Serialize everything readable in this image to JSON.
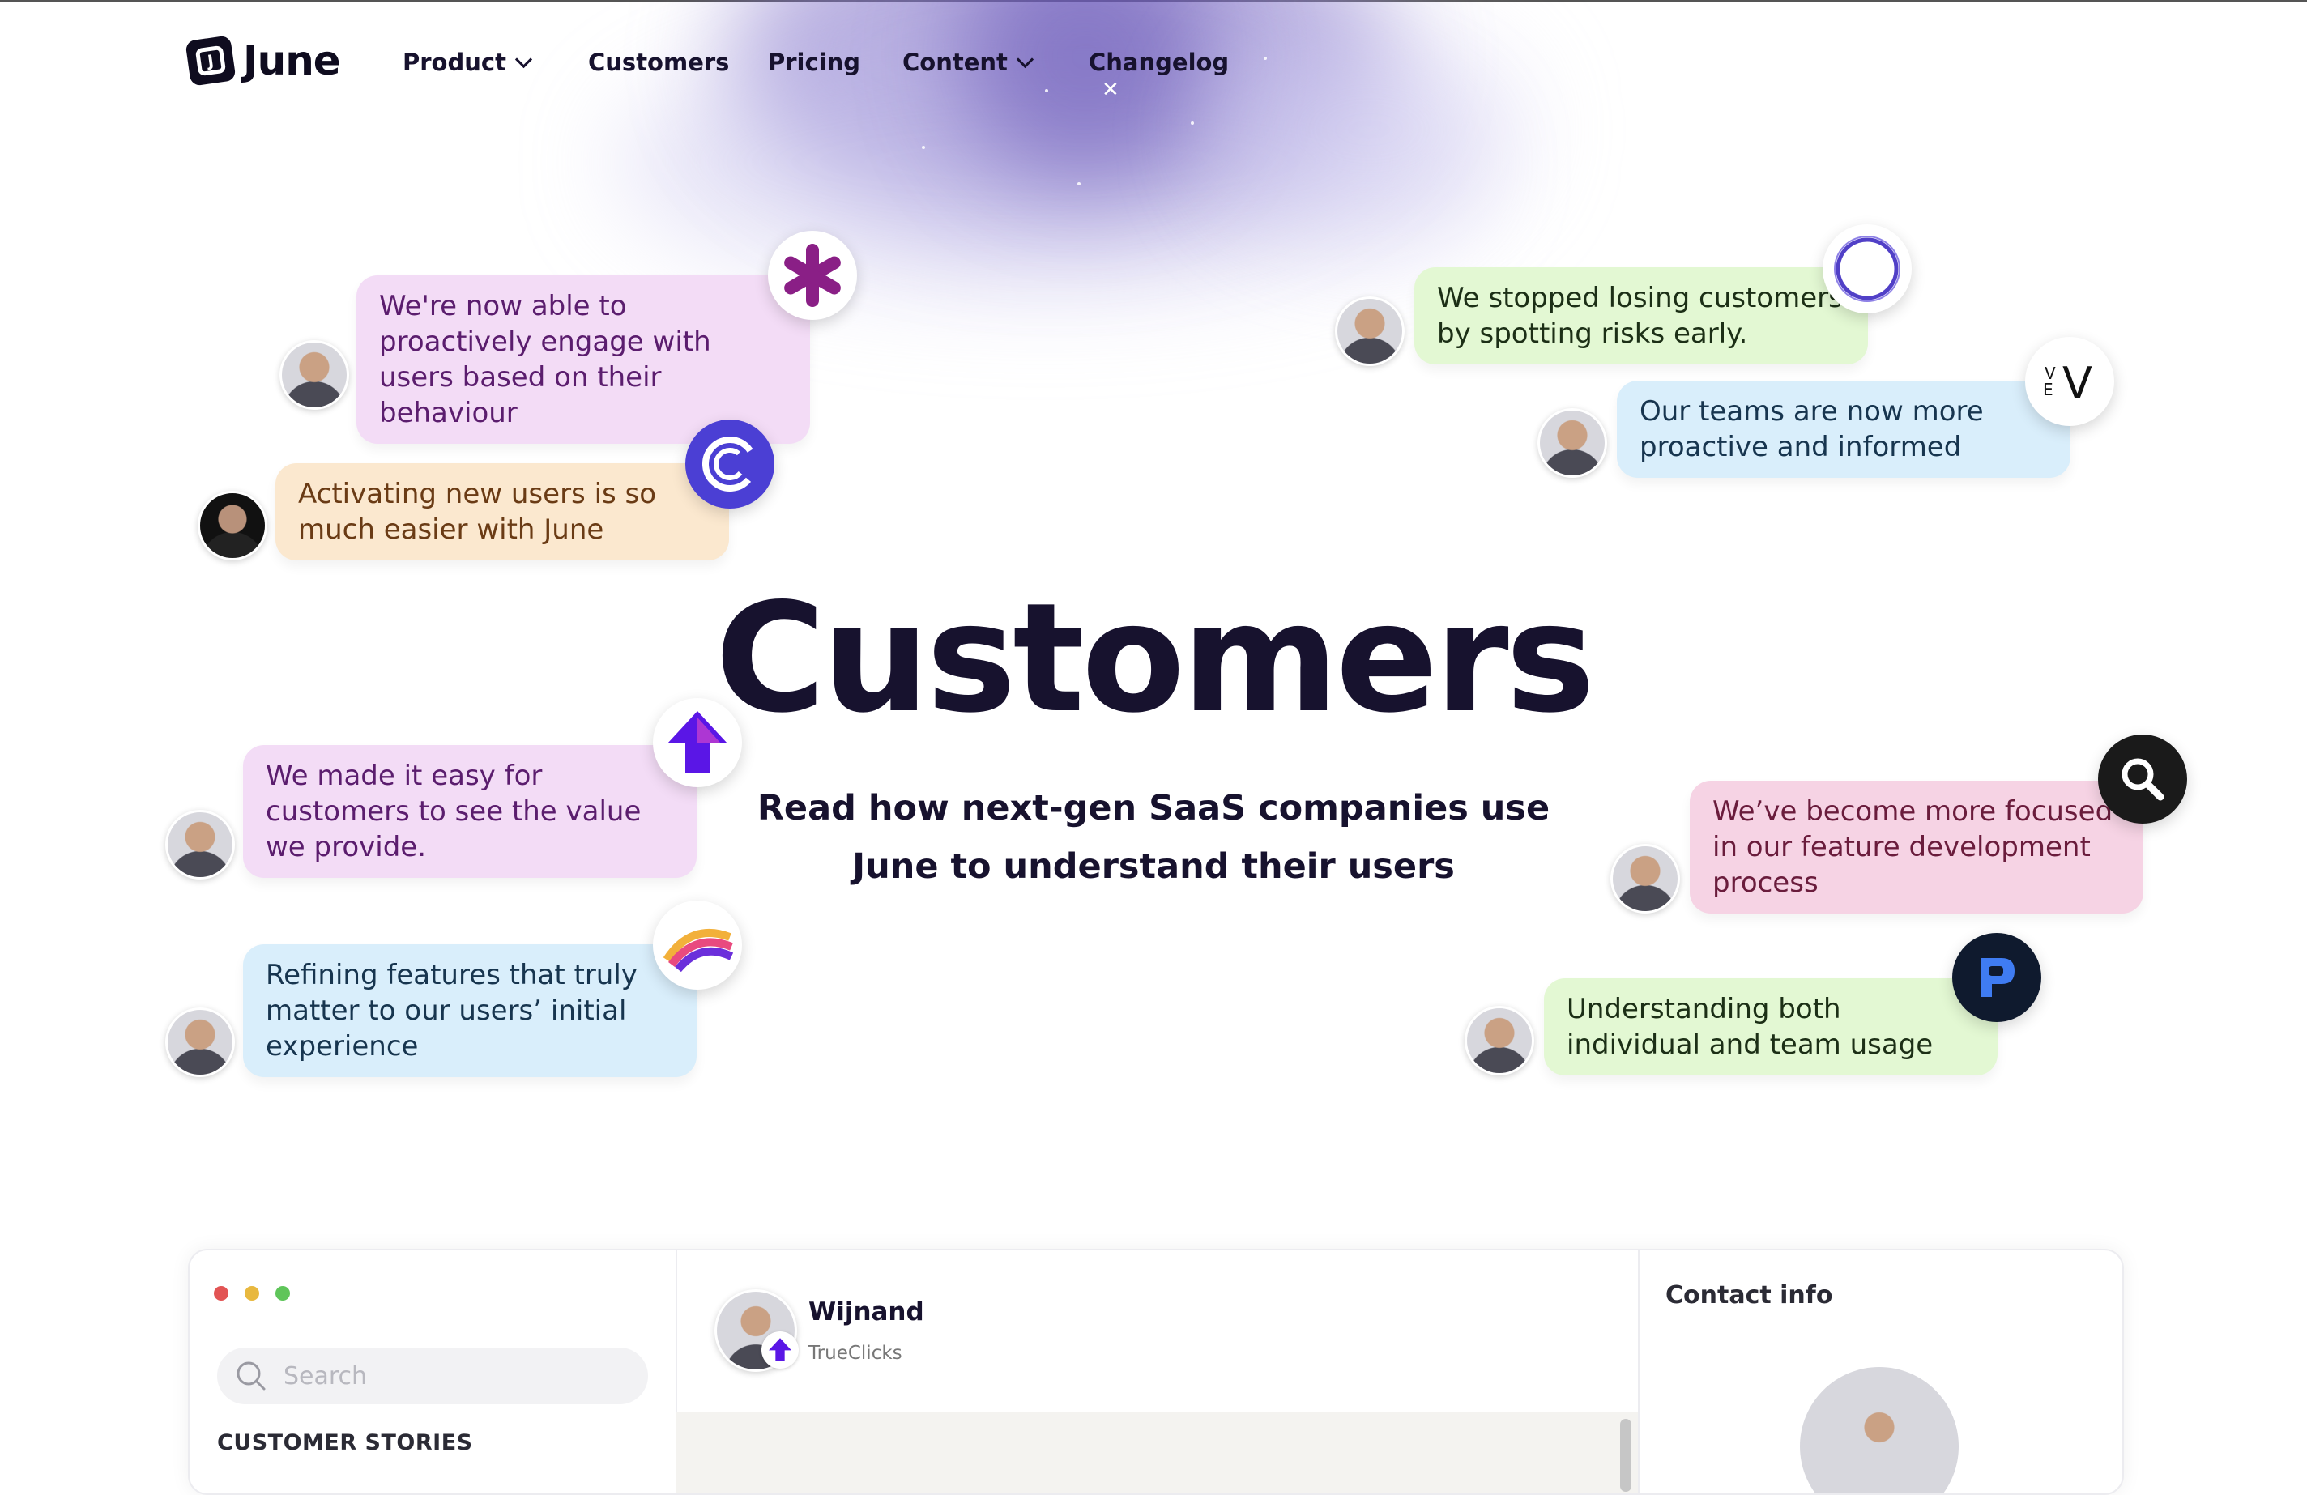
{
  "brand": {
    "name": "June"
  },
  "nav": [
    {
      "label": "Product",
      "has_dropdown": true
    },
    {
      "label": "Customers",
      "has_dropdown": false
    },
    {
      "label": "Pricing",
      "has_dropdown": false
    },
    {
      "label": "Content",
      "has_dropdown": true
    },
    {
      "label": "Changelog",
      "has_dropdown": false
    }
  ],
  "hero": {
    "title": "Customers",
    "subtitle_line1": "Read how next-gen SaaS companies use",
    "subtitle_line2": "June to understand their users"
  },
  "testimonials": [
    {
      "text": "We're now able to proactively engage with users based on their behaviour",
      "color": "#f3dcf6",
      "icon": "asterisk-logo-icon"
    },
    {
      "text": "Activating new users is so much easier with June",
      "color": "#fbe8cf",
      "icon": "c-circle-logo-icon"
    },
    {
      "text": "We made it easy for customers to see the value we provide.",
      "color": "#f3dcf6",
      "icon": "up-arrow-logo-icon"
    },
    {
      "text": "Refining features that truly matter to our users’ initial experience",
      "color": "#d9eefb",
      "icon": "rainbow-logo-icon"
    },
    {
      "text": "We stopped losing customers by spotting risks early.",
      "color": "#e3f8d3",
      "icon": "ring-logo-icon"
    },
    {
      "text": "Our teams are now more proactive and informed",
      "color": "#d9eefb",
      "icon": "vev-logo-icon"
    },
    {
      "text": "We’ve become more focused in our feature development process",
      "color": "#f6d3e4",
      "icon": "search-logo-icon"
    },
    {
      "text": "Understanding both individual and team usage",
      "color": "#e3f8d3",
      "icon": "p-logo-icon"
    }
  ],
  "app_preview": {
    "window_dots": [
      "#e25454",
      "#e8b83f",
      "#5fc55a"
    ],
    "search_placeholder": "Search",
    "section_label": "CUSTOMER STORIES",
    "contact_name": "Wijnand",
    "contact_company": "TrueClicks",
    "contact_info_title": "Contact info"
  }
}
